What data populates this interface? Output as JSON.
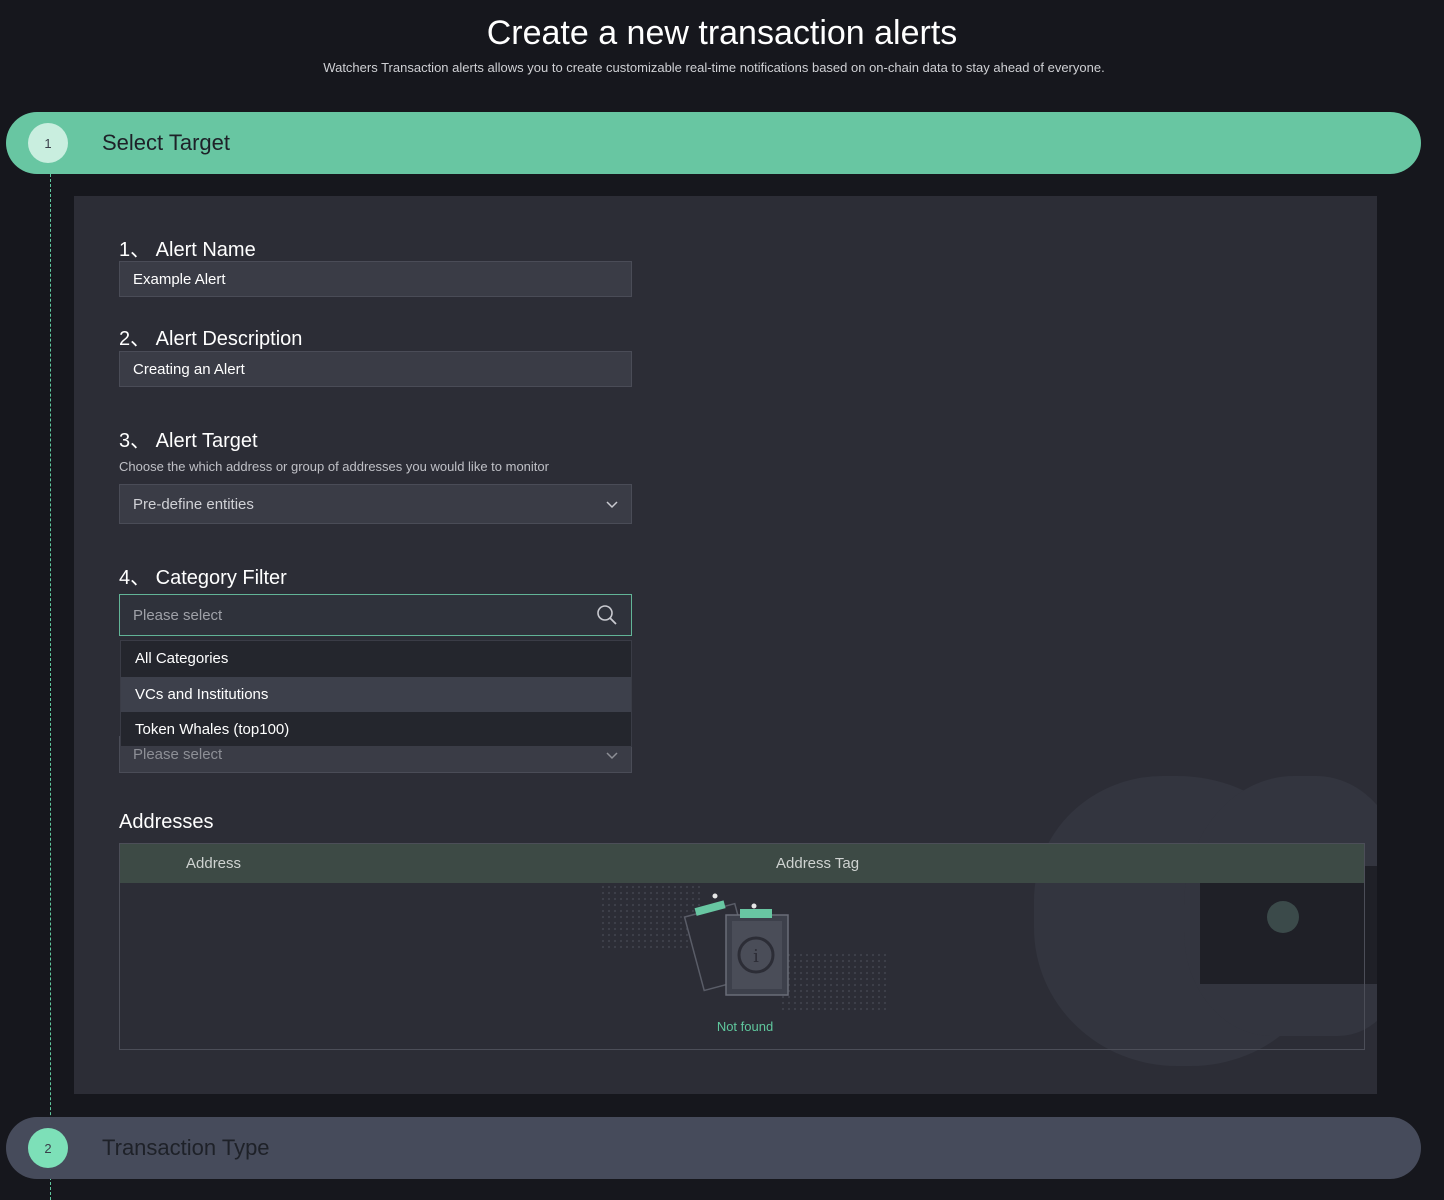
{
  "page": {
    "title": "Create a new transaction alerts",
    "subtitle": "Watchers Transaction alerts allows you to create customizable real-time notifications based on on-chain data to stay ahead of everyone."
  },
  "steps": [
    {
      "number": "1",
      "label": "Select Target",
      "state": "active"
    },
    {
      "number": "2",
      "label": "Transaction Type",
      "state": "inactive"
    }
  ],
  "form": {
    "alert_name": {
      "label": "1、 Alert Name",
      "value": "Example Alert"
    },
    "alert_description": {
      "label": "2、 Alert Description",
      "value": "Creating an Alert"
    },
    "alert_target": {
      "label": "3、 Alert Target",
      "hint": "Choose the which address or group of addresses you would like to monitor",
      "selected": "Pre-define entities"
    },
    "category_filter": {
      "label": "4、 Category Filter",
      "placeholder": "Please select",
      "options": [
        "All Categories",
        "VCs and Institutions",
        "Token Whales (top100)"
      ]
    },
    "next_select": {
      "placeholder": "Please select"
    }
  },
  "addresses": {
    "title": "Addresses",
    "columns": [
      "Address",
      "Address Tag"
    ],
    "empty_text": "Not found"
  },
  "colors": {
    "accent": "#68c6a2",
    "background": "#16171d",
    "panel": "#2c2d36"
  }
}
